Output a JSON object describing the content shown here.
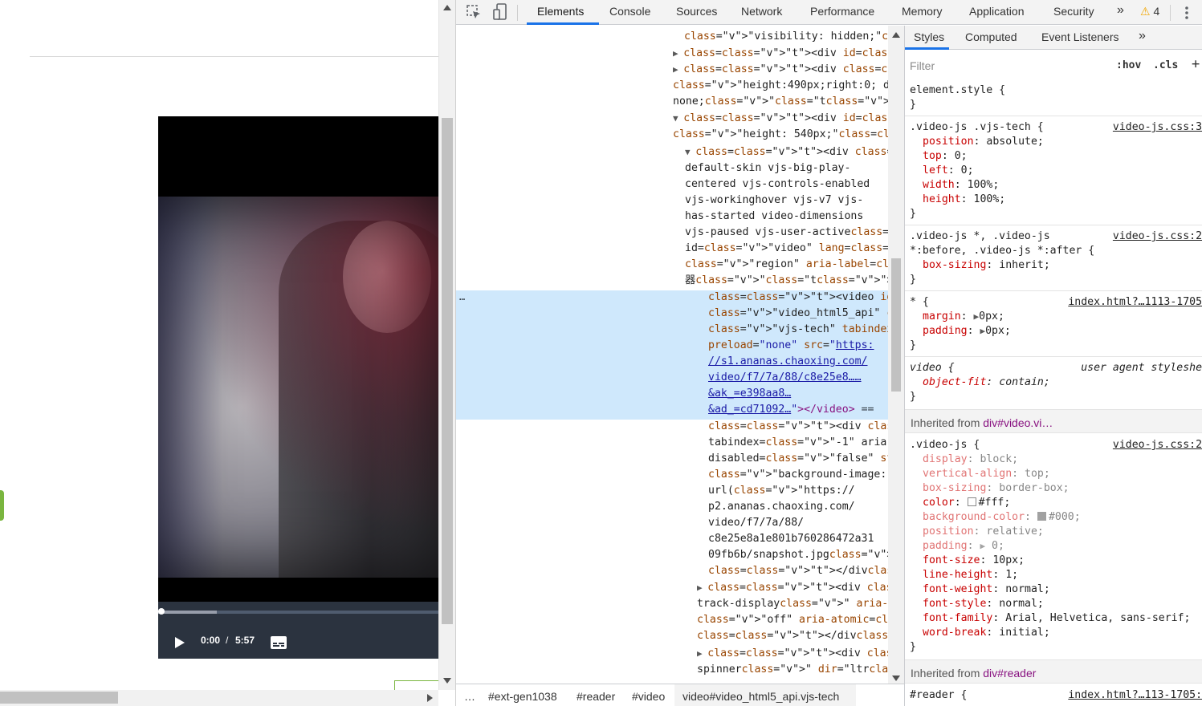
{
  "player": {
    "time_current": "0:00",
    "time_separator": "/",
    "time_duration": "5:57",
    "progress_loaded": 0.21,
    "progress_played": 0.0
  },
  "devtools": {
    "tabs": [
      "Elements",
      "Console",
      "Sources",
      "Network",
      "Performance",
      "Memory",
      "Application",
      "Security"
    ],
    "more_tabs": "»",
    "warning_count": "4",
    "warning_icon": "warning-icon",
    "elements_lines": [
      "\"visibility: hidden;\"></div>",
      "<div id=\"note\">…</div>",
      "<div class=\"rage_list\" style=",
      "\"height:490px;right:0; display:",
      "none;\">…</div>",
      "<div id=\"reader\" style=",
      "\"height: 540px;\">",
      "<div class=\"video-js vjs-",
      "default-skin vjs-big-play-",
      "centered vjs-controls-enabled",
      "vjs-workinghover vjs-v7 vjs-",
      "has-started video-dimensions",
      "vjs-paused vjs-user-active\"",
      "id=\"video\" lang=\"zh-cn\" role=",
      "\"region\" aria-label=\"视频播放",
      "器\">",
      "<video id=",
      "\"video_html5_api\" class=",
      "\"vjs-tech\" tabindex=\"-1\"",
      "preload=\"none\" src=\"https:",
      "//s1.ananas.chaoxing.com/",
      "video/f7/7a/88/c8e25e8……",
      "&ak_=e398aa8…",
      "&ad_=cd71092…\"></video> ==",
      "<div class=\"vjs-poster\"",
      "tabindex=\"-1\" aria-",
      "disabled=\"false\" style=",
      "\"background-image:",
      "url(\"https://",
      "p2.ananas.chaoxing.com/",
      "video/f7/7a/88/",
      "c8e25e8a1e801b760286472a31",
      "09fb6b/snapshot.jpg\");\">",
      "</div>",
      "<div class=\"vjs-text-",
      "track-display\" aria-live=",
      "\"off\" aria-atomic=\"true\">…",
      "</div>",
      "<div class=\"vjs-loading-",
      "spinner\" dir=\"ltr\">…</div>"
    ],
    "ellipsis": "…",
    "breadcrumbs": [
      "…",
      "#ext-gen1038",
      "#reader",
      "#video",
      "video#video_html5_api.vjs-tech"
    ],
    "styles_tabs": [
      "Styles",
      "Computed",
      "Event Listeners",
      "»"
    ],
    "filter_placeholder": "Filter",
    "hov": ":hov",
    "cls": ".cls",
    "plus": "+",
    "rules": {
      "element_style": "element.style {",
      "close": "}",
      "r1_sel": ".video-js .vjs-tech {",
      "r1_src": "video-js.css:30",
      "r1_props": [
        [
          "position",
          "absolute;"
        ],
        [
          "top",
          "0;"
        ],
        [
          "left",
          "0;"
        ],
        [
          "width",
          "100%;"
        ],
        [
          "height",
          "100%;"
        ]
      ],
      "r2_sel1": ".video-js *, .video-js",
      "r2_sel2": "*:before, .video-js *:after {",
      "r2_src": "video-js.css:27",
      "r2_props": [
        [
          "box-sizing",
          "inherit;"
        ]
      ],
      "r3_sel": "* {",
      "r3_src": "index.html?…1113-1705:",
      "r3_props": [
        [
          "margin",
          "0px;"
        ],
        [
          "padding",
          "0px;"
        ]
      ],
      "r4_sel": "video {",
      "r4_src": "user agent styleshee",
      "r4_props": [
        [
          "object-fit",
          "contain;"
        ]
      ],
      "inh1_prefix": "Inherited from ",
      "inh1_el": "div#video.vi…",
      "r5_sel": ".video-js {",
      "r5_src": "video-js.css:25",
      "r5_props": [
        [
          "display",
          "block;"
        ],
        [
          "vertical-align",
          "top;"
        ],
        [
          "box-sizing",
          "border-box;"
        ],
        [
          "color",
          "#fff;"
        ],
        [
          "background-color",
          "#000;"
        ],
        [
          "position",
          "relative;"
        ],
        [
          "padding",
          "0;"
        ],
        [
          "font-size",
          "10px;"
        ],
        [
          "line-height",
          "1;"
        ],
        [
          "font-weight",
          "normal;"
        ],
        [
          "font-style",
          "normal;"
        ],
        [
          "font-family",
          "Arial, Helvetica, sans-serif;"
        ],
        [
          "word-break",
          "initial;"
        ]
      ],
      "inh2_prefix": "Inherited from ",
      "inh2_el": "div#reader",
      "r6_sel": "#reader {",
      "r6_src": "index.html?…113-1705:4"
    }
  }
}
